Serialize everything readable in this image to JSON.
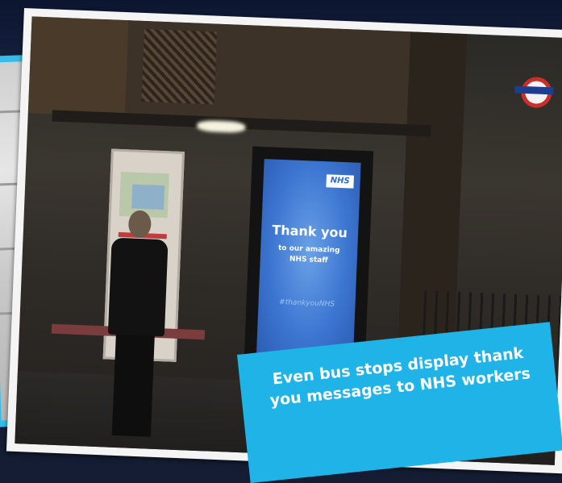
{
  "ad": {
    "logo": "NHS",
    "title": "Thank you",
    "subtitle": "to our amazing NHS staff",
    "hashtag": "#thankyouNHS"
  },
  "caption": {
    "text": "Even bus stops display thank you messages to NHS workers"
  },
  "colors": {
    "caption_background": "#1fb3e8",
    "frame_accent": "#35bde8",
    "ad_screen": "#3c76d1"
  }
}
